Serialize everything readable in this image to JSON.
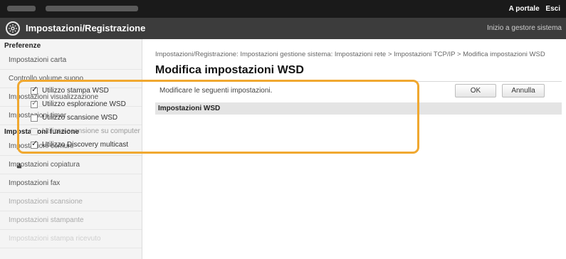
{
  "topbar": {
    "links": [
      "A portale",
      "Esci"
    ]
  },
  "header": {
    "icon": "gear-icon",
    "title": "Impostazioni/Registrazione",
    "home_link": "Inizio a gestore sistema"
  },
  "sidebar": {
    "sections": [
      {
        "title": "Preferenze",
        "items": [
          {
            "label": "Impostazioni carta"
          },
          {
            "label": "Controllo volume suono"
          },
          {
            "label": "Impostazioni visualizzazione"
          },
          {
            "label": "Impostazioni timer"
          }
        ]
      },
      {
        "title": "Impostazioni funzione",
        "items": [
          {
            "label": "Impostazioni comuni"
          },
          {
            "label": "Impostazioni copiatura"
          },
          {
            "label": "Impostazioni fax"
          },
          {
            "label": "Impostazioni scansione"
          },
          {
            "label": "Impostazioni stampante"
          },
          {
            "label": "Impostazioni stampa ricevuto"
          }
        ]
      }
    ]
  },
  "main": {
    "breadcrumb": "Impostazioni/Registrazione: Impostazioni gestione sistema: Impostazioni rete > Impostazioni TCP/IP > Modifica impostazioni WSD",
    "title": "Modifica impostazioni WSD",
    "instruction": "Modificare le seguenti impostazioni.",
    "ok_label": "OK",
    "cancel_label": "Annulla",
    "section_title": "Impostazioni WSD",
    "options": [
      {
        "label": "Utilizzo stampa WSD",
        "checked": true,
        "enabled": true
      },
      {
        "label": "Utilizzo esplorazione WSD",
        "checked": true,
        "enabled": true
      },
      {
        "label": "Utilizzo scansione WSD",
        "checked": false,
        "enabled": true
      },
      {
        "label": "Utilizzo scansione su computer",
        "checked": false,
        "enabled": false
      },
      {
        "label": "Utilizzo Discovery multicast",
        "checked": true,
        "enabled": true
      }
    ],
    "highlight_color": "#f0a830"
  }
}
